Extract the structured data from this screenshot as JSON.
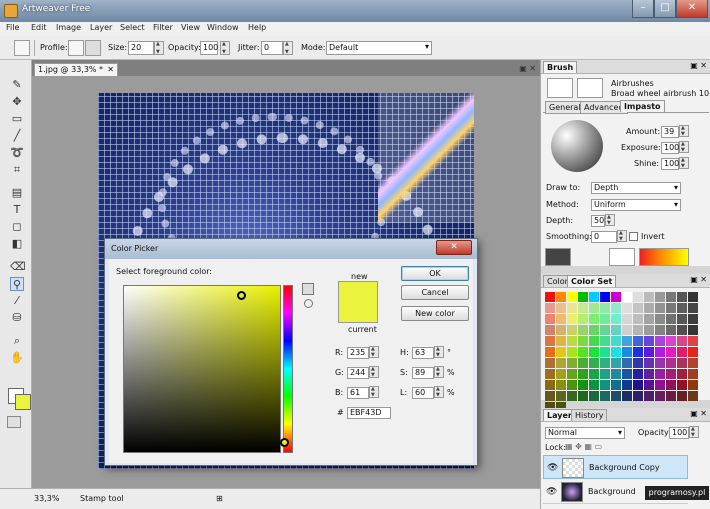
{
  "window": {
    "title": "Artweaver Free"
  },
  "menu": [
    "File",
    "Edit",
    "Image",
    "Layer",
    "Select",
    "Filter",
    "View",
    "Window",
    "Help"
  ],
  "options_bar": {
    "profile_label": "Profile:",
    "size_label": "Size:",
    "size_value": "20",
    "opacity_label": "Opacity:",
    "opacity_value": "100",
    "jitter_label": "Jitter:",
    "jitter_value": "0",
    "mode_label": "Mode:",
    "mode_value": "Default"
  },
  "document": {
    "tab_label": "1.jpg @ 33,3% *"
  },
  "status": {
    "zoom": "33,3%",
    "tool": "Stamp tool"
  },
  "brush_panel": {
    "title": "Brush",
    "category": "Airbrushes",
    "brush_name": "Broad wheel airbrush 10",
    "tabs": [
      "General",
      "Advanced",
      "Impasto"
    ],
    "active_tab": "Impasto",
    "amount_label": "Amount:",
    "amount_value": "39",
    "exposure_label": "Exposure:",
    "exposure_value": "100",
    "shine_label": "Shine:",
    "shine_value": "100",
    "draw_to_label": "Draw to:",
    "draw_to_value": "Depth",
    "method_label": "Method:",
    "method_value": "Uniform",
    "depth_label": "Depth:",
    "depth_value": "50",
    "smoothing_label": "Smoothing:",
    "smoothing_value": "0",
    "invert_label": "Invert"
  },
  "color_panel": {
    "tabs": [
      "Color",
      "Color Set"
    ],
    "active_tab": "Color Set"
  },
  "layers_panel": {
    "tabs": [
      "Layers",
      "History"
    ],
    "active_tab": "Layers",
    "blend_mode": "Normal",
    "opacity_label": "Opacity:",
    "opacity_value": "100",
    "lock_label": "Lock:",
    "layers": [
      {
        "name": "Background Copy",
        "selected": true
      },
      {
        "name": "Background",
        "selected": false
      }
    ]
  },
  "color_picker": {
    "title": "Color Picker",
    "prompt": "Select foreground color:",
    "new_label": "new",
    "current_label": "current",
    "ok_label": "OK",
    "cancel_label": "Cancel",
    "new_color_label": "New color",
    "r_label": "R:",
    "r_value": "235",
    "g_label": "G:",
    "g_value": "244",
    "b_label": "B:",
    "b_value": "61",
    "h_label": "H:",
    "h_value": "63",
    "h_unit": "°",
    "s_label": "S:",
    "s_value": "89",
    "s_unit": "%",
    "l_label": "L:",
    "l_value": "60",
    "l_unit": "%",
    "hex_label": "#",
    "hex_value": "EBF43D",
    "new_color_hex": "#EBF43D",
    "current_color_hex": "#EBF43D"
  },
  "watermark": "programosy.pl",
  "colors": {
    "foreground": "#EBF43D",
    "background": "#FFFFFF"
  }
}
